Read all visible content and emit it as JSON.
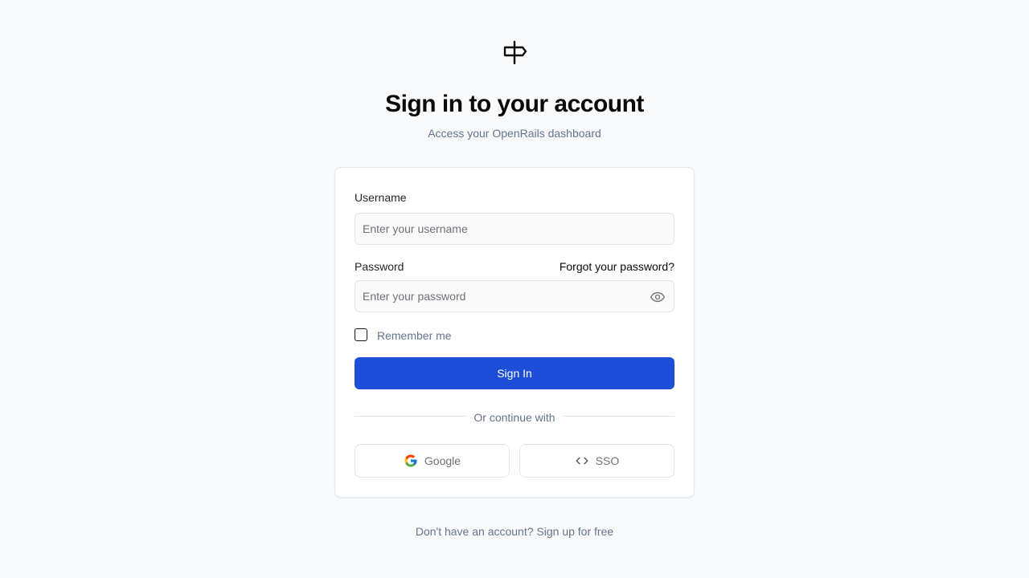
{
  "header": {
    "logo_icon": "signpost-icon",
    "title": "Sign in to your account",
    "subtitle": "Access your OpenRails dashboard"
  },
  "form": {
    "username_label": "Username",
    "username_placeholder": "Enter your username",
    "username_value": "",
    "password_label": "Password",
    "password_placeholder": "Enter your password",
    "password_value": "",
    "forgot_link": "Forgot your password?",
    "show_password_icon": "eye-icon",
    "remember_label": "Remember me",
    "remember_checked": false,
    "submit_label": "Sign In"
  },
  "divider": {
    "text": "Or continue with"
  },
  "social": {
    "google_label": "Google",
    "google_icon": "google-icon",
    "sso_label": "SSO",
    "sso_icon": "code-icon"
  },
  "footer": {
    "prompt": "Don't have an account?",
    "signup_link": "Sign up for free"
  },
  "colors": {
    "background": "#f8fafc",
    "primary": "#1d4ed8",
    "muted_text": "#64748b",
    "border": "#e4e4e7"
  }
}
